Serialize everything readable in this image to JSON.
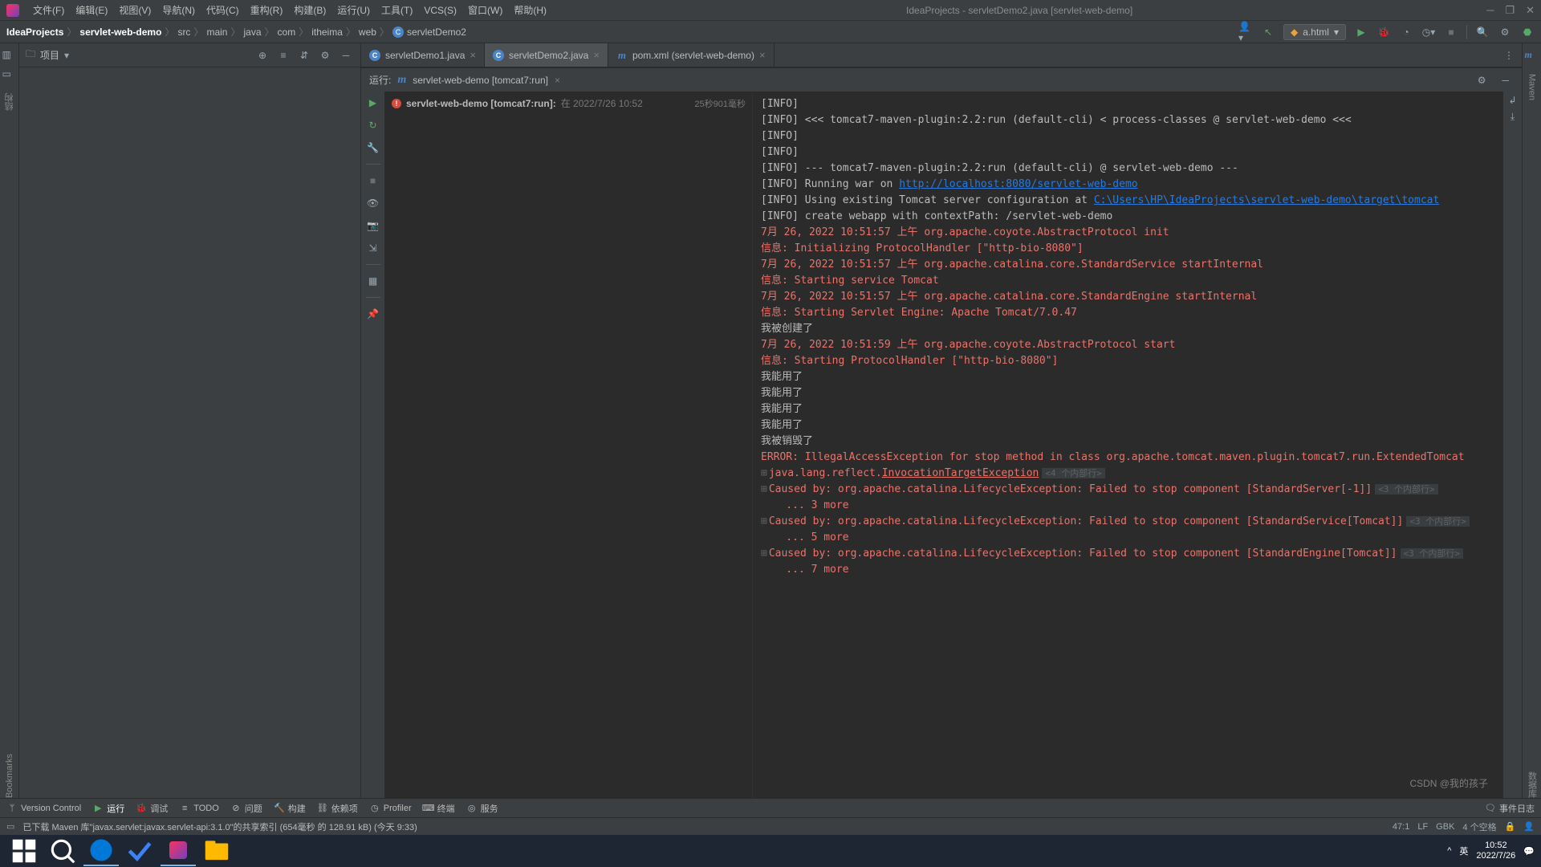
{
  "window": {
    "title": "IdeaProjects - servletDemo2.java [servlet-web-demo]"
  },
  "menu": [
    "文件(F)",
    "编辑(E)",
    "视图(V)",
    "导航(N)",
    "代码(C)",
    "重构(R)",
    "构建(B)",
    "运行(U)",
    "工具(T)",
    "VCS(S)",
    "窗口(W)",
    "帮助(H)"
  ],
  "breadcrumbs": [
    "IdeaProjects",
    "servlet-web-demo",
    "src",
    "main",
    "java",
    "com",
    "itheima",
    "web",
    "servletDemo2"
  ],
  "run_config": "a.html",
  "project_panel": {
    "title": "项目"
  },
  "editor_tabs": [
    {
      "icon": "c",
      "label": "servletDemo1.java",
      "active": false
    },
    {
      "icon": "c",
      "label": "servletDemo2.java",
      "active": true
    },
    {
      "icon": "m",
      "label": "pom.xml (servlet-web-demo)",
      "active": false
    }
  ],
  "run_panel": {
    "label": "运行:",
    "config": "servlet-web-demo [tomcat7:run]",
    "tree_name": "servlet-web-demo [tomcat7:run]:",
    "tree_time": "在 2022/7/26 10:52",
    "duration": "25秒901毫秒"
  },
  "console_lines": [
    {
      "cls": "info",
      "text": "[INFO]"
    },
    {
      "cls": "info",
      "text": "[INFO] <<< tomcat7-maven-plugin:2.2:run (default-cli) < process-classes @ servlet-web-demo <<<"
    },
    {
      "cls": "info",
      "text": "[INFO]"
    },
    {
      "cls": "info",
      "text": "[INFO]"
    },
    {
      "cls": "info",
      "text": "[INFO] --- tomcat7-maven-plugin:2.2:run (default-cli) @ servlet-web-demo ---"
    },
    {
      "cls": "info",
      "text": "[INFO] Running war on ",
      "link": "http://localhost:8080/servlet-web-demo"
    },
    {
      "cls": "info",
      "text": "[INFO] Using existing Tomcat server configuration at ",
      "link": "C:\\Users\\HP\\IdeaProjects\\servlet-web-demo\\target\\tomcat"
    },
    {
      "cls": "info",
      "text": "[INFO] create webapp with contextPath: /servlet-web-demo"
    },
    {
      "cls": "warn",
      "text": "7月 26, 2022 10:51:57 上午 org.apache.coyote.AbstractProtocol init"
    },
    {
      "cls": "warn",
      "text": "信息: Initializing ProtocolHandler [\"http-bio-8080\"]"
    },
    {
      "cls": "warn",
      "text": "7月 26, 2022 10:51:57 上午 org.apache.catalina.core.StandardService startInternal"
    },
    {
      "cls": "warn",
      "text": "信息: Starting service Tomcat"
    },
    {
      "cls": "warn",
      "text": "7月 26, 2022 10:51:57 上午 org.apache.catalina.core.StandardEngine startInternal"
    },
    {
      "cls": "warn",
      "text": "信息: Starting Servlet Engine: Apache Tomcat/7.0.47"
    },
    {
      "cls": "info",
      "text": "我被创建了"
    },
    {
      "cls": "warn",
      "text": "7月 26, 2022 10:51:59 上午 org.apache.coyote.AbstractProtocol start"
    },
    {
      "cls": "warn",
      "text": "信息: Starting ProtocolHandler [\"http-bio-8080\"]"
    },
    {
      "cls": "info",
      "text": "我能用了"
    },
    {
      "cls": "info",
      "text": "我能用了"
    },
    {
      "cls": "info",
      "text": "我能用了"
    },
    {
      "cls": "info",
      "text": "我能用了"
    },
    {
      "cls": "info",
      "text": "我被销毁了"
    },
    {
      "cls": "err",
      "text": "ERROR: IllegalAccessException for stop method in class org.apache.tomcat.maven.plugin.tomcat7.run.ExtendedTomcat"
    },
    {
      "cls": "err",
      "expand": true,
      "text": "java.lang.reflect.",
      "uline": "InvocationTargetException",
      "fold": "<4 个内部行>"
    },
    {
      "cls": "err",
      "expand": true,
      "text": "Caused by: org.apache.catalina.LifecycleException: Failed to stop component [StandardServer[-1]]",
      "fold": "<3 个内部行>"
    },
    {
      "cls": "err",
      "text": "    ... 3 more"
    },
    {
      "cls": "err",
      "expand": true,
      "text": "Caused by: org.apache.catalina.LifecycleException: Failed to stop component [StandardService[Tomcat]]",
      "fold": "<3 个内部行>"
    },
    {
      "cls": "err",
      "text": "    ... 5 more"
    },
    {
      "cls": "err",
      "expand": true,
      "text": "Caused by: org.apache.catalina.LifecycleException: Failed to stop component [StandardEngine[Tomcat]]",
      "fold": "<3 个内部行>"
    },
    {
      "cls": "err",
      "text": "    ... 7 more"
    }
  ],
  "bottom_tools": [
    {
      "icon": "branch",
      "label": "Version Control"
    },
    {
      "icon": "play",
      "label": "运行",
      "active": true
    },
    {
      "icon": "bug",
      "label": "调试"
    },
    {
      "icon": "todo",
      "label": "TODO"
    },
    {
      "icon": "q",
      "label": "问题"
    },
    {
      "icon": "hammer",
      "label": "构建"
    },
    {
      "icon": "dep",
      "label": "依赖项"
    },
    {
      "icon": "profiler",
      "label": "Profiler"
    },
    {
      "icon": "term",
      "label": "终端"
    },
    {
      "icon": "svc",
      "label": "服务"
    }
  ],
  "status": {
    "message": "已下载 Maven 库\"javax.servlet:javax.servlet-api:3.1.0\"的共享索引 (654毫秒 的 128.91 kB) (今天 9:33)",
    "event_log": "事件日志",
    "caret": "47:1",
    "line_sep": "LF",
    "encoding": "GBK",
    "indent": "4 个空格"
  },
  "taskbar": {
    "ime": "英",
    "time": "10:52",
    "date": "2022/7/26"
  },
  "watermark": "CSDN @我的孩子"
}
